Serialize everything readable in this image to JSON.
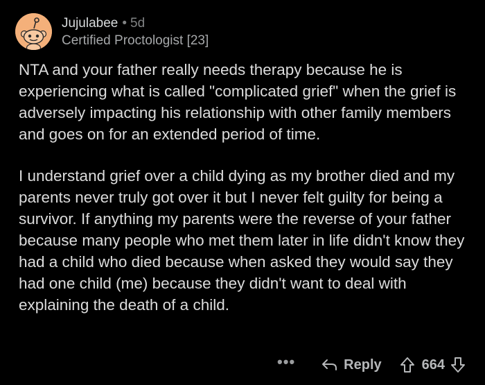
{
  "comment": {
    "username": "Jujulabee",
    "separator": "•",
    "age": "5d",
    "flair": "Certified Proctologist [23]",
    "avatar_icon": "snoo-avatar-icon",
    "avatar_color": "#f4b07a",
    "paragraphs": [
      "NTA and your father really needs therapy because he is experiencing what is called \"complicated grief\" when the grief is adversely impacting his relationship with other family members and goes on for an extended period of time.",
      "I understand grief over a child dying as my brother died and my parents never truly got over it but I never felt guilty for being a survivor. If anything my parents were the reverse of your father because many people who met them later in life didn't know they had a child who died because when asked they would say they had one child (me) because they didn't want to deal with explaining the death of a child."
    ]
  },
  "actions": {
    "more_label": "•••",
    "reply_label": "Reply",
    "score": "664",
    "icons": [
      "more-options-icon",
      "reply-arrow-icon",
      "upvote-arrow-icon",
      "downvote-arrow-icon"
    ]
  },
  "colors": {
    "background": "#000000",
    "text": "#dcdcdc",
    "meta": "#818384"
  }
}
